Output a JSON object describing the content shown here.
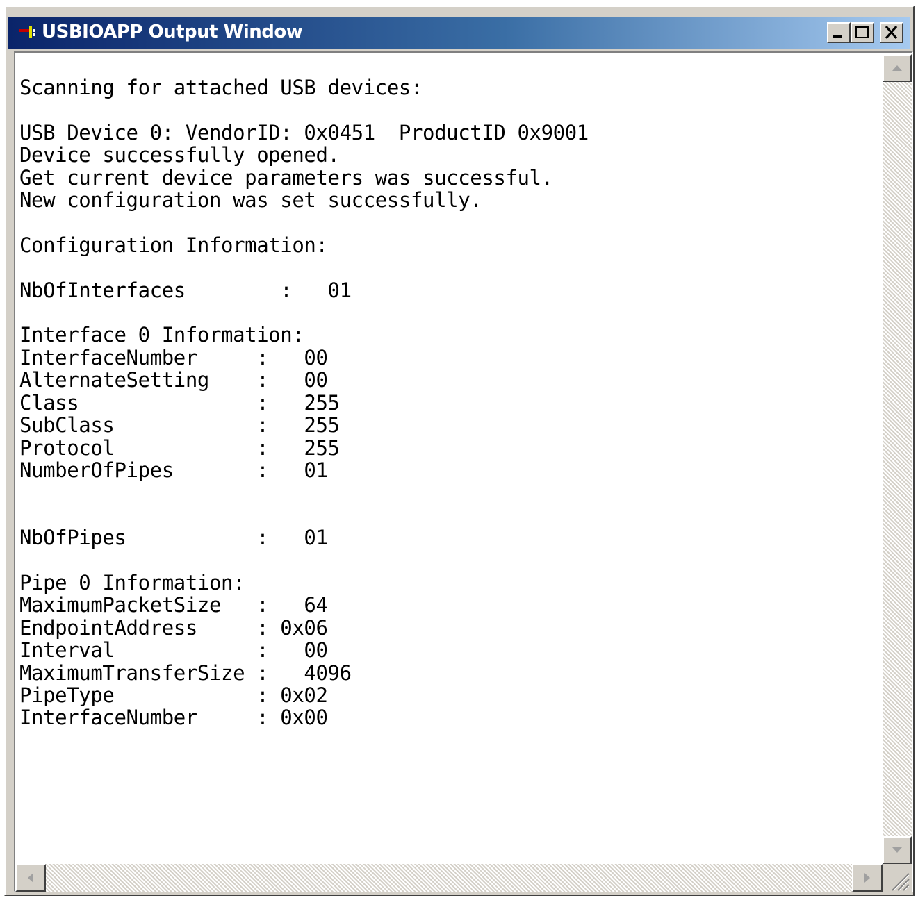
{
  "window": {
    "title": "USBIOAPP Output Window"
  },
  "output": {
    "lines": [
      "Scanning for attached USB devices:",
      "",
      "USB Device 0: VendorID: 0x0451  ProductID 0x9001",
      "Device successfully opened.",
      "Get current device parameters was successful.",
      "New configuration was set successfully.",
      "",
      "Configuration Information:",
      "",
      "NbOfInterfaces        :   01",
      "",
      "Interface 0 Information:",
      "InterfaceNumber     :   00",
      "AlternateSetting    :   00",
      "Class               :   255",
      "SubClass            :   255",
      "Protocol            :   255",
      "NumberOfPipes       :   01",
      "",
      "",
      "NbOfPipes           :   01",
      "",
      "Pipe 0 Information:",
      "MaximumPacketSize   :   64",
      "EndpointAddress     : 0x06",
      "Interval            :   00",
      "MaximumTransferSize :   4096",
      "PipeType            : 0x02",
      "InterfaceNumber     : 0x00"
    ]
  },
  "colors": {
    "title_gradient_start": "#0a246a",
    "title_gradient_end": "#a6caf0",
    "face": "#d4d0c8"
  }
}
